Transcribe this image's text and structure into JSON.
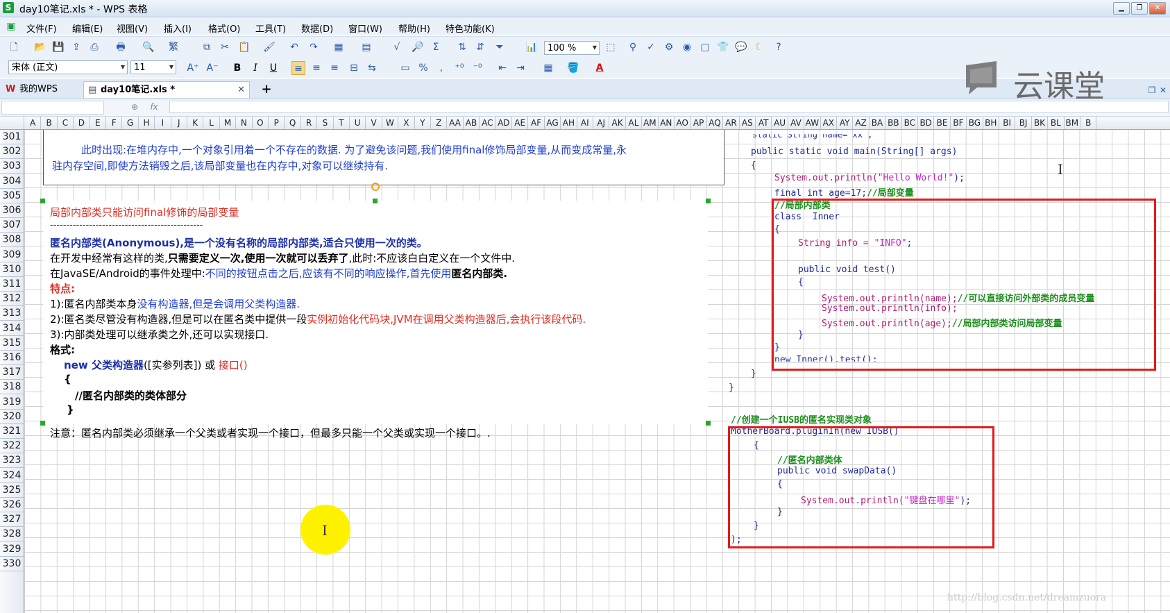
{
  "window": {
    "title": "day10笔记.xls * - WPS 表格",
    "logo": "S"
  },
  "menu": [
    "文件(F)",
    "编辑(E)",
    "视图(V)",
    "插入(I)",
    "格式(O)",
    "工具(T)",
    "数据(D)",
    "窗口(W)",
    "帮助(H)",
    "特色功能(K)"
  ],
  "toolbar": {
    "zoom": "100 %",
    "font_name": "宋体 (正文)",
    "font_size": "11",
    "bold": "B",
    "italic": "I",
    "underline": "U",
    "percent": "%",
    "sigma": "Σ",
    "fx": "fx"
  },
  "tabs": {
    "home": "我的WPS",
    "doc": "day10笔记.xls *",
    "add": "+"
  },
  "columns": [
    "A",
    "B",
    "C",
    "D",
    "E",
    "F",
    "G",
    "H",
    "I",
    "J",
    "K",
    "L",
    "M",
    "N",
    "O",
    "P",
    "Q",
    "R",
    "S",
    "T",
    "U",
    "V",
    "W",
    "X",
    "Y",
    "Z",
    "AA",
    "AB",
    "AC",
    "AD",
    "AE",
    "AF",
    "AG",
    "AH",
    "AI",
    "AJ",
    "AK",
    "AL",
    "AM",
    "AN",
    "AO",
    "AP",
    "AQ",
    "AR",
    "AS",
    "AT",
    "AU",
    "AV",
    "AW",
    "AX",
    "AY",
    "AZ",
    "BA",
    "BB",
    "BC",
    "BD",
    "BE",
    "BF",
    "BG",
    "BH",
    "BI",
    "BJ",
    "BK",
    "BL",
    "BM",
    "B"
  ],
  "rows": [
    "301",
    "302",
    "303",
    "304",
    "305",
    "306",
    "307",
    "308",
    "309",
    "310",
    "311",
    "312",
    "313",
    "314",
    "315",
    "316",
    "317",
    "318",
    "319",
    "320",
    "321",
    "322",
    "323",
    "324",
    "325",
    "326",
    "327",
    "328",
    "329",
    "330"
  ],
  "upper_box": {
    "line1": "此时出现:在堆内存中,一个对象引用着一个不存在的数据. 为了避免该问题,我们使用final修饰局部变量,从而变成常量,永",
    "line2": "驻内存空间,即使方法销毁之后,该局部变量也在内存中,对象可以继续持有."
  },
  "notes": {
    "l305": "局部内部类只能访问final修饰的局部变量",
    "l306": "-----------------------------------------------",
    "l307": "匿名内部类(Anonymous),是一个没有名称的局部内部类,适合只使用一次的类。",
    "l308a": "在开发中经常有这样的类,",
    "l308b": "只需要定义一次,使用一次就可以丢弃了",
    "l308c": ",此时:不应该白白定义在一个文件中.",
    "l309a": "在JavaSE/Android的事件处理中:",
    "l309b": "不同的按钮点击之后,应该有不同的响应操作,首先使用",
    "l309c": "匿名内部类.",
    "l310": "特点:",
    "l311a": "1):匿名内部类本身",
    "l311b": "没有构造器,但是会调用父类构造器.",
    "l312a": "2):匿名类尽管没有构造器,但是可以在匿名类中提供一段",
    "l312b": "实例初始化代码块,JVM在调用父类构造器后,会执行该段代码.",
    "l313": "3):内部类处理可以继承类之外,还可以实现接口.",
    "l314": "格式:",
    "l315a": "new ",
    "l315b": "父类构造器",
    "l315c": "([实参列表]) 或 ",
    "l315d": "接口()",
    "l316": "{",
    "l317": "//匿名内部类的类体部分",
    "l318": "}",
    "l319": "注意：匿名内部类必须继承一个父类或者实现一个接口，但最多只能一个父类或实现一个接口。."
  },
  "code1": {
    "c0": "static String name=\"xx\";",
    "c1": "public static void main(String[] args)",
    "c2": "{",
    "c3a": "System.out.println(",
    "c3b": "\"Hello World!\"",
    "c3c": ");",
    "c4a": "final int age=17;",
    "c4b": "//局部变量",
    "c5": "//局部内部类",
    "c6": "class  Inner",
    "c7": "{",
    "c8a": "String info = ",
    "c8b": "\"INFO\"",
    "c8c": ";",
    "c9": "public void test()",
    "c10": "{",
    "c11a": "System.out.println(name);",
    "c11b": "//可以直接访问外部类的成员变量",
    "c12": "System.out.println(info);",
    "c13a": "System.out.println(age);",
    "c13b": "//局部内部类访问局部变量",
    "c14": "}",
    "c15": "}",
    "c16": "new Inner().test();",
    "c17": "}",
    "c18": "}"
  },
  "code2": {
    "c0": "//创建一个IUSB的匿名实现类对象",
    "c1": "MotherBoard.pluginIn(new IUSB()",
    "c2": "{",
    "c3": "//匿名内部类体",
    "c4": "public void swapData()",
    "c5": "{",
    "c6a": "System.out.println(",
    "c6b": "\"键盘在哪里\"",
    "c6c": ");",
    "c7": "}",
    "c8": "}",
    "c9": ");"
  },
  "watermark": {
    "brand": "云课堂",
    "csdn": "http://blog.csdn.net/dreamzuora"
  },
  "colors": {
    "accent_red": "#e51a1a",
    "text_blue": "#1f3fd1",
    "highlight_yellow": "#fff200"
  }
}
